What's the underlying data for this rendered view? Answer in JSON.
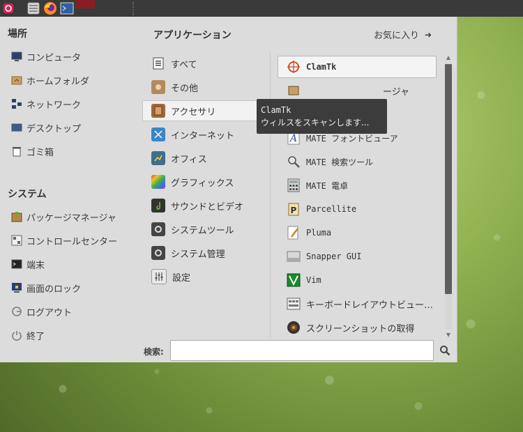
{
  "panel": {
    "launchers": [
      {
        "icon": "mate-menu-icon",
        "color": "#d4245a"
      },
      {
        "icon": "file-manager-icon",
        "color": "#cfcfcf"
      },
      {
        "icon": "firefox-icon",
        "color": "#ff7a1a"
      },
      {
        "icon": "terminal-monitor-icon",
        "color": "#3d6fb6"
      }
    ]
  },
  "places": {
    "title": "場所",
    "items": [
      {
        "label": "コンピュータ",
        "icon": "computer-icon"
      },
      {
        "label": "ホームフォルダ",
        "icon": "home-folder-icon"
      },
      {
        "label": "ネットワーク",
        "icon": "network-icon"
      },
      {
        "label": "デスクトップ",
        "icon": "desktop-icon"
      },
      {
        "label": "ゴミ箱",
        "icon": "trash-icon"
      }
    ]
  },
  "system": {
    "title": "システム",
    "items": [
      {
        "label": "パッケージマネージャ",
        "icon": "package-manager-icon"
      },
      {
        "label": "コントロールセンター",
        "icon": "control-center-icon"
      },
      {
        "label": "端末",
        "icon": "terminal-icon"
      },
      {
        "label": "画面のロック",
        "icon": "lock-screen-icon"
      },
      {
        "label": "ログアウト",
        "icon": "logout-icon"
      },
      {
        "label": "終了",
        "icon": "power-icon"
      }
    ]
  },
  "applications": {
    "title": "アプリケーション",
    "favorites_label": "お気に入り",
    "categories": [
      {
        "label": "すべて",
        "icon": "all-apps-icon"
      },
      {
        "label": "その他",
        "icon": "other-icon"
      },
      {
        "label": "アクセサリ",
        "icon": "accessories-icon",
        "selected": true
      },
      {
        "label": "インターネット",
        "icon": "internet-icon"
      },
      {
        "label": "オフィス",
        "icon": "office-icon"
      },
      {
        "label": "グラフィックス",
        "icon": "graphics-icon"
      },
      {
        "label": "サウンドとビデオ",
        "icon": "sound-video-icon"
      },
      {
        "label": "システムツール",
        "icon": "system-tools-icon"
      },
      {
        "label": "システム管理",
        "icon": "system-admin-icon"
      },
      {
        "label": "設定",
        "icon": "settings-icon"
      }
    ],
    "apps": [
      {
        "label": "ClamTk",
        "icon": "clamtk-icon",
        "selected": true
      },
      {
        "label": "ージャ",
        "icon": "archive-manager-icon"
      },
      {
        "label": "",
        "icon": "engrampa-icon"
      },
      {
        "label": "MATE フォントビューア",
        "icon": "font-viewer-icon"
      },
      {
        "label": "MATE 検索ツール",
        "icon": "search-tool-icon"
      },
      {
        "label": "MATE 電卓",
        "icon": "calculator-icon"
      },
      {
        "label": "Parcellite",
        "icon": "parcellite-icon"
      },
      {
        "label": "Pluma",
        "icon": "pluma-icon"
      },
      {
        "label": "Snapper GUI",
        "icon": "snapper-icon"
      },
      {
        "label": "Vim",
        "icon": "vim-icon"
      },
      {
        "label": "キーボードレイアウトビュー…",
        "icon": "keyboard-layout-icon"
      },
      {
        "label": "スクリーンショットの取得",
        "icon": "screenshot-icon"
      }
    ]
  },
  "tooltip": {
    "title": "ClamTk",
    "subtitle": "ウィルスをスキャンします..."
  },
  "search": {
    "label": "検索:",
    "value": "",
    "placeholder": ""
  }
}
